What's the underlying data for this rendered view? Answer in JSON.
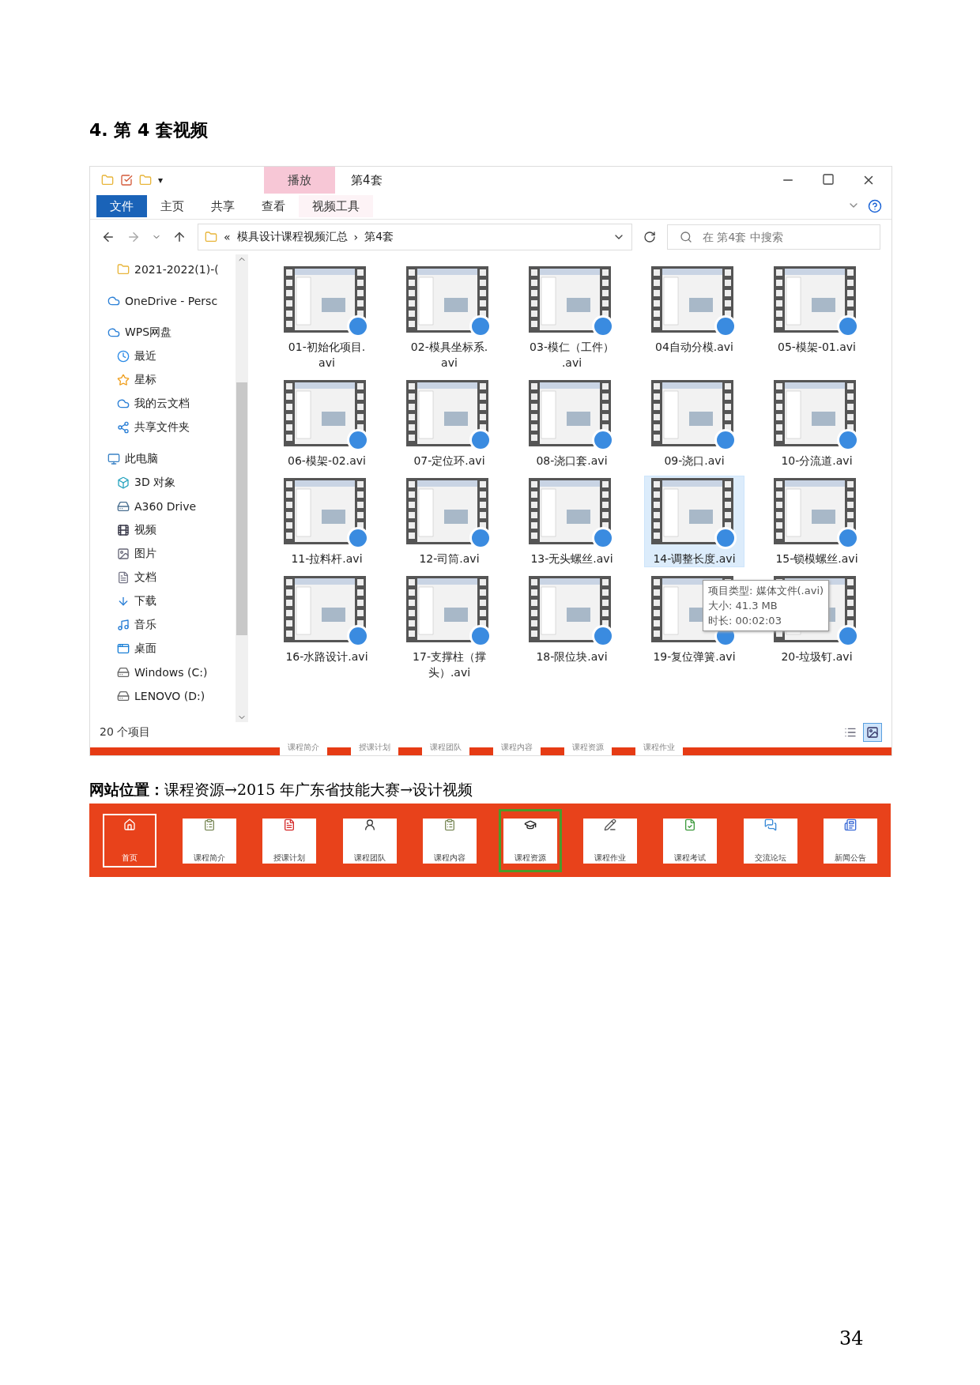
{
  "heading": "4. 第 4 套视频",
  "explorer": {
    "title": "第4套",
    "quick_access_dropdown": "▾",
    "context_group": "播放",
    "ribbon_tabs": [
      {
        "label": "文件",
        "kind": "file",
        "selected": false
      },
      {
        "label": "主页",
        "kind": "tab",
        "selected": false
      },
      {
        "label": "共享",
        "kind": "tab",
        "selected": false
      },
      {
        "label": "查看",
        "kind": "tab",
        "selected": false
      },
      {
        "label": "视频工具",
        "kind": "context",
        "selected": false
      }
    ],
    "address": {
      "prefix": "«",
      "separator": "›",
      "path": [
        "模具设计课程视频汇总",
        "第4套"
      ]
    },
    "search": {
      "placeholder": "在 第4套 中搜索"
    },
    "sidebar": [
      {
        "label": "2021-2022(1)-(",
        "kind": "folder",
        "indent": true
      },
      {
        "label": "OneDrive - Persc",
        "kind": "cloud"
      },
      {
        "label": "WPS网盘",
        "kind": "cloud",
        "children": [
          {
            "label": "最近",
            "kind": "clock"
          },
          {
            "label": "星标",
            "kind": "star"
          },
          {
            "label": "我的云文档",
            "kind": "cloud"
          },
          {
            "label": "共享文件夹",
            "kind": "share"
          }
        ]
      },
      {
        "label": "此电脑",
        "kind": "computer",
        "children": [
          {
            "label": "3D 对象",
            "kind": "cube"
          },
          {
            "label": "A360 Drive",
            "kind": "drive"
          },
          {
            "label": "视频",
            "kind": "video"
          },
          {
            "label": "图片",
            "kind": "image"
          },
          {
            "label": "文档",
            "kind": "document"
          },
          {
            "label": "下载",
            "kind": "download"
          },
          {
            "label": "音乐",
            "kind": "music"
          },
          {
            "label": "桌面",
            "kind": "desktop"
          },
          {
            "label": "Windows (C:)",
            "kind": "disk"
          },
          {
            "label": "LENOVO (D:)",
            "kind": "disk"
          }
        ]
      }
    ],
    "files": [
      {
        "name": "01-初始化项目.\navi",
        "selected": false
      },
      {
        "name": "02-模具坐标系.\navi",
        "selected": false
      },
      {
        "name": "03-模仁（工件）\n.avi",
        "selected": false
      },
      {
        "name": "04自动分模.avi",
        "selected": false
      },
      {
        "name": "05-模架-01.avi",
        "selected": false
      },
      {
        "name": "06-模架-02.avi",
        "selected": false
      },
      {
        "name": "07-定位环.avi",
        "selected": false
      },
      {
        "name": "08-浇口套.avi",
        "selected": false
      },
      {
        "name": "09-浇口.avi",
        "selected": false
      },
      {
        "name": "10-分流道.avi",
        "selected": false
      },
      {
        "name": "11-拉料杆.avi",
        "selected": false
      },
      {
        "name": "12-司筒.avi",
        "selected": false
      },
      {
        "name": "13-无头螺丝.avi",
        "selected": false
      },
      {
        "name": "14-调整长度.avi",
        "selected": true
      },
      {
        "name": "15-锁模螺丝.avi",
        "selected": false
      },
      {
        "name": "16-水路设计.avi",
        "selected": false
      },
      {
        "name": "17-支撑柱（撑头）.avi",
        "selected": false
      },
      {
        "name": "18-限位块.avi",
        "selected": false
      },
      {
        "name": "19-复位弹簧.avi",
        "selected": false
      },
      {
        "name": "20-垃圾钉.avi",
        "selected": false
      }
    ],
    "tooltip": [
      "项目类型: 媒体文件(.avi)",
      "大小: 41.3 MB",
      "时长: 00:02:03"
    ],
    "status": "20 个项目",
    "views": [
      {
        "kind": "details",
        "selected": false
      },
      {
        "kind": "large",
        "selected": true
      }
    ],
    "background_strip": [
      "课程简介",
      "授课计划",
      "课程团队",
      "课程内容",
      "课程资源",
      "课程作业"
    ]
  },
  "caption": "**网站位置：**课程资源→2015 年广东省技能大赛→设计视频",
  "nav": [
    {
      "label": "首页",
      "kind": "home",
      "active": true,
      "selected": false
    },
    {
      "label": "课程简介",
      "kind": "clipboard",
      "active": false,
      "selected": false
    },
    {
      "label": "授课计划",
      "kind": "plan",
      "active": false,
      "selected": false
    },
    {
      "label": "课程团队",
      "kind": "team",
      "active": false,
      "selected": false
    },
    {
      "label": "课程内容",
      "kind": "clipboard",
      "active": false,
      "selected": false
    },
    {
      "label": "课程资源",
      "kind": "cap",
      "active": false,
      "selected": true
    },
    {
      "label": "课程作业",
      "kind": "pencil",
      "active": false,
      "selected": false
    },
    {
      "label": "课程考试",
      "kind": "exam",
      "active": false,
      "selected": false
    },
    {
      "label": "交流论坛",
      "kind": "chat",
      "active": false,
      "selected": false
    },
    {
      "label": "新闻公告",
      "kind": "news",
      "active": false,
      "selected": false
    }
  ],
  "page_number": "34"
}
